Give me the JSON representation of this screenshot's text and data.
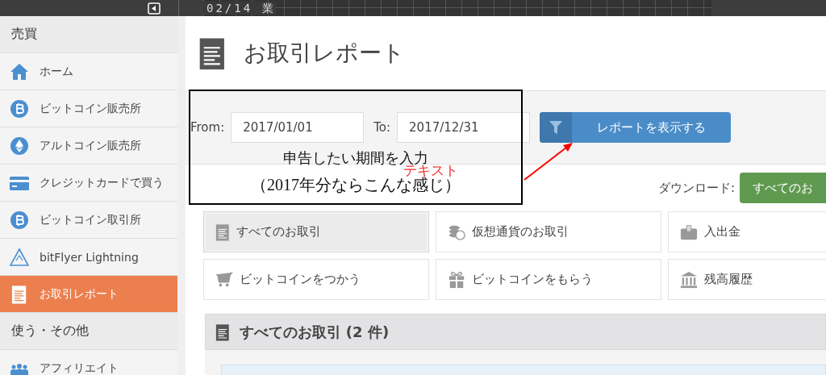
{
  "top_bar": {
    "date_text": "02/14 業"
  },
  "sidebar": {
    "sections": [
      {
        "title": "売買",
        "items": [
          {
            "label": "ホーム",
            "selected": false
          },
          {
            "label": "ビットコイン販売所",
            "selected": false
          },
          {
            "label": "アルトコイン販売所",
            "selected": false
          },
          {
            "label": "クレジットカードで買う",
            "selected": false
          },
          {
            "label": "ビットコイン取引所",
            "selected": false
          },
          {
            "label": "bitFlyer Lightning",
            "selected": false
          },
          {
            "label": "お取引レポート",
            "selected": true
          }
        ]
      },
      {
        "title": "使う・その他",
        "items": [
          {
            "label": "アフィリエイト",
            "selected": false
          }
        ]
      }
    ]
  },
  "page": {
    "title": "お取引レポート"
  },
  "filter": {
    "from_label": "From:",
    "from_value": "2017/01/01",
    "to_label": "To:",
    "to_value": "2017/12/31",
    "button": "レポートを表示する"
  },
  "annotation": {
    "lines": [
      "申告したい期間を入力",
      "（2017年分ならこんな感じ）"
    ],
    "note": "テキスト"
  },
  "download": {
    "label": "ダウンロード:",
    "button": "すべてのお"
  },
  "categories": [
    {
      "label": "すべてのお取引",
      "selected": true
    },
    {
      "label": "仮想通貨のお取引",
      "selected": false
    },
    {
      "label": "入出金",
      "selected": false
    },
    {
      "label": "ビットコインをつかう",
      "selected": false
    },
    {
      "label": "ビットコインをもらう",
      "selected": false
    },
    {
      "label": "残高履歴",
      "selected": false
    }
  ],
  "section": {
    "title": "すべてのお取引 (2 件)"
  }
}
